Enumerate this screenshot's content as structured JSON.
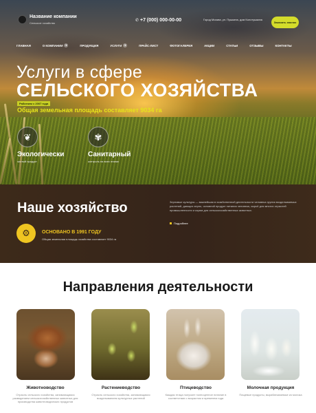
{
  "header": {
    "brand_name": "Название компании",
    "brand_sub": "Сельское хозяйство",
    "phone": "+7 (000) 000-00-00",
    "address": "Город Москва, ул. Пушкина, дом Колотушкина",
    "cta_label": "Заказать звонок"
  },
  "nav": {
    "items": [
      {
        "label": "Главная"
      },
      {
        "label": "О компании"
      },
      {
        "label": "Продукция"
      },
      {
        "label": "Услуги"
      },
      {
        "label": "Прайс-лист"
      },
      {
        "label": "Фотогалерея"
      },
      {
        "label": "Акции"
      },
      {
        "label": "Статьи"
      },
      {
        "label": "Отзывы"
      },
      {
        "label": "Контакты"
      }
    ]
  },
  "hero": {
    "title_line1": "Услуги в сфере",
    "title_line2": "СЕЛЬСКОГО ХОЗЯЙСТВА",
    "since": "Работаем с 2007 года",
    "area": "Общая земельная площадь составляет 9034 га",
    "features": [
      {
        "title": "Экологически",
        "sub": "чистый продукт"
      },
      {
        "title": "Санитарный",
        "sub": "контроль на всех этапах"
      }
    ]
  },
  "about": {
    "title": "Наше хозяйство",
    "founded_title": "ОСНОВАНО В 1991 ГОДУ",
    "founded_sub": "Общая земельная площадь хозяйства составляет 9034 га",
    "text": "Зерновые культуры — важнейшая в хозяйственной деятельности человека группа возделываемых растений, дающих зерно, основной продукт питания человека, сырьё для многих отраслей промышленности и корма для сельскохозяйственных животных.",
    "more_label": "Подробнее"
  },
  "directions": {
    "title": "Направления деятельности",
    "cards": [
      {
        "title": "Животноводство",
        "sub": "Отрасль сельского хозяйства, занимающаяся разведением сельскохозяйственных животных для производства животноводческих продуктов"
      },
      {
        "title": "Растениеводство",
        "sub": "Отрасль сельского хозяйства, занимающаяся возделыванием культурных растений"
      },
      {
        "title": "Птицеводство",
        "sub": "Каждая птица получает полноценное питание в соответствии с возрастом и временем года"
      },
      {
        "title": "Молочная продукция",
        "sub": "Пищевые продукты, вырабатываемые из молока"
      }
    ]
  }
}
